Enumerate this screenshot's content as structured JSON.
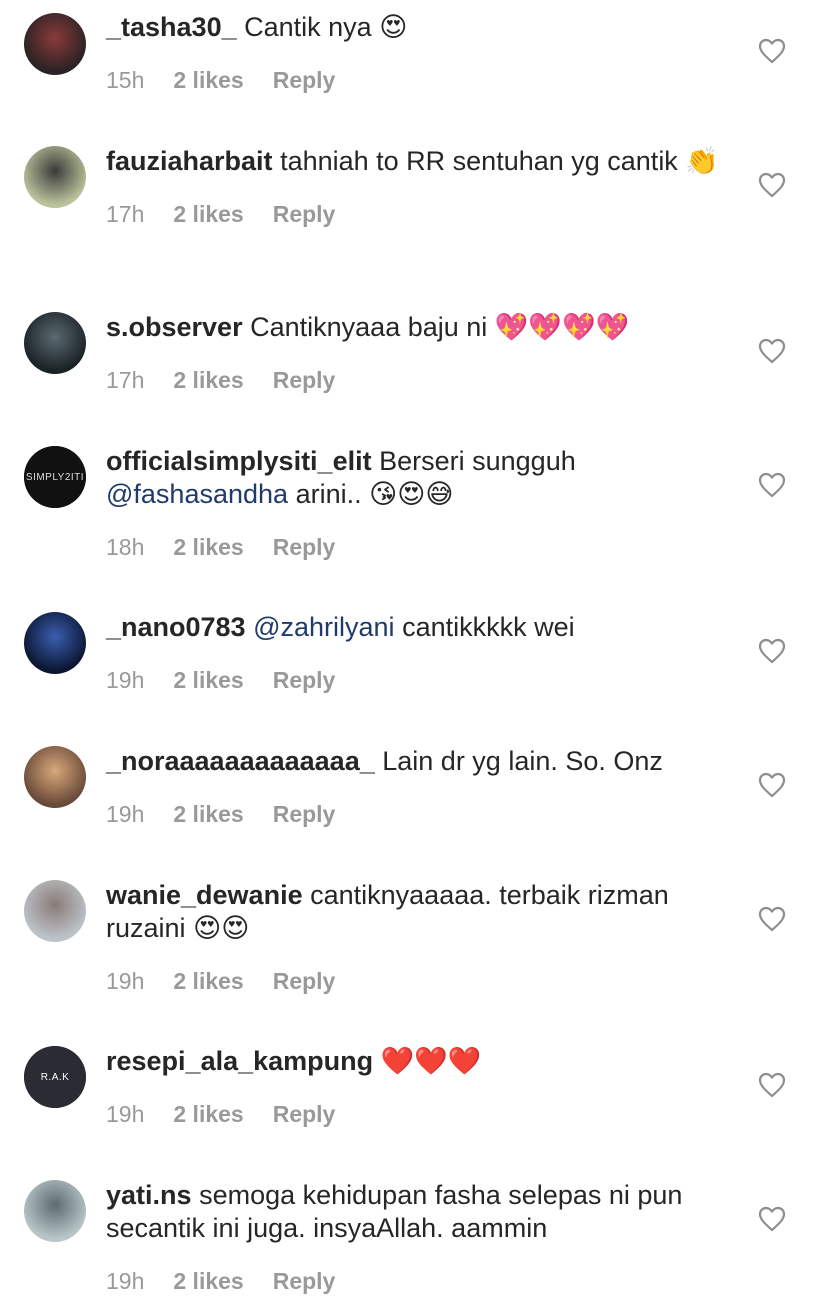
{
  "comments": [
    {
      "username": "_tasha30_",
      "segments": [
        {
          "t": "Cantik nya",
          "k": "text"
        },
        {
          "t": "😍",
          "k": "emoji"
        }
      ],
      "time": "15h",
      "likes": "2 likes",
      "reply": "Reply"
    },
    {
      "username": "fauziaharbait",
      "segments": [
        {
          "t": "tahniah to RR sentuhan yg cantik",
          "k": "text"
        },
        {
          "t": "👏",
          "k": "emoji"
        }
      ],
      "time": "17h",
      "likes": "2 likes",
      "reply": "Reply"
    },
    {
      "username": "s.observer",
      "segments": [
        {
          "t": "Cantiknyaaa baju ni",
          "k": "text"
        },
        {
          "t": "💖💖💖💖",
          "k": "emoji"
        }
      ],
      "time": "17h",
      "likes": "2 likes",
      "reply": "Reply"
    },
    {
      "username": "officialsimplysiti_elit",
      "segments": [
        {
          "t": "Berseri sungguh",
          "k": "text"
        },
        {
          "t": "@fashasandha",
          "k": "mention"
        },
        {
          "t": "arini..",
          "k": "text"
        },
        {
          "t": "😘😍😅",
          "k": "emoji"
        }
      ],
      "time": "18h",
      "likes": "2 likes",
      "reply": "Reply"
    },
    {
      "username": "_nano0783",
      "segments": [
        {
          "t": "@zahrilyani",
          "k": "mention"
        },
        {
          "t": "cantikkkkk wei",
          "k": "text"
        }
      ],
      "time": "19h",
      "likes": "2 likes",
      "reply": "Reply"
    },
    {
      "username": "_noraaaaaaaaaaaaa_",
      "segments": [
        {
          "t": "Lain dr yg lain. So. Onz",
          "k": "text"
        }
      ],
      "time": "19h",
      "likes": "2 likes",
      "reply": "Reply"
    },
    {
      "username": "wanie_dewanie",
      "segments": [
        {
          "t": "cantiknyaaaaa. terbaik rizman ruzaini",
          "k": "text"
        },
        {
          "t": "😍😍",
          "k": "emoji"
        }
      ],
      "time": "19h",
      "likes": "2 likes",
      "reply": "Reply"
    },
    {
      "username": "resepi_ala_kampung",
      "segments": [
        {
          "t": "❤️❤️❤️",
          "k": "emoji"
        }
      ],
      "time": "19h",
      "likes": "2 likes",
      "reply": "Reply"
    },
    {
      "username": "yati.ns",
      "segments": [
        {
          "t": "semoga kehidupan fasha selepas ni pun secantik ini juga. insyaAllah. aammin",
          "k": "text"
        }
      ],
      "time": "19h",
      "likes": "2 likes",
      "reply": "Reply"
    }
  ],
  "avatars": [
    {
      "bg": "#2a2224",
      "fg": "#8a3a3a"
    },
    {
      "bg": "#b9c29a",
      "fg": "#3b3b3b"
    },
    {
      "bg": "#1b2226",
      "fg": "#5a6a70"
    },
    {
      "bg": "#111111",
      "fg": "#dddddd",
      "label": "SIMPLY2ITI"
    },
    {
      "bg": "#0c1633",
      "fg": "#3a5fb0"
    },
    {
      "bg": "#6a4a3a",
      "fg": "#d8a87a"
    },
    {
      "bg": "#bcc3c8",
      "fg": "#8a7a78"
    },
    {
      "bg": "#2b2b34",
      "fg": "#ffffff",
      "label": "R.A.K"
    },
    {
      "bg": "#b9c6c8",
      "fg": "#5b6b70"
    }
  ],
  "colors": {
    "meta": "#999999",
    "mention": "#1f3a6b",
    "heart_stroke": "#8e8e8e"
  },
  "icons": {
    "heart": "heart-outline-icon"
  }
}
